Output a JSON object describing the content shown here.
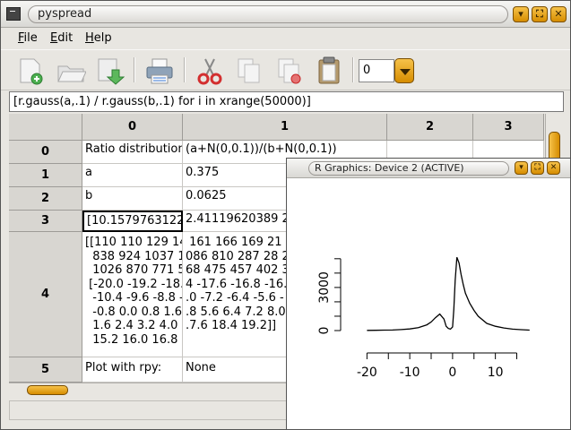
{
  "window": {
    "title": "pyspread"
  },
  "menu": [
    {
      "label": "File",
      "underline": "F",
      "rest": "ile"
    },
    {
      "label": "Edit",
      "underline": "E",
      "rest": "dit"
    },
    {
      "label": "Help",
      "underline": "H",
      "rest": "elp"
    }
  ],
  "toolbar": {
    "icons": [
      "new-icon",
      "open-icon",
      "save-icon",
      "print-icon",
      "cut-icon",
      "copy-icon",
      "copy-result-icon",
      "paste-icon"
    ],
    "table_selector": "0"
  },
  "formula": "[r.gauss(a,.1) / r.gauss(b,.1) for i in xrange(50000)]",
  "grid": {
    "columns": [
      "0",
      "1",
      "2",
      "3"
    ],
    "rows": [
      {
        "label": "0",
        "c0": "Ratio distribution",
        "c1": "(a+N(0,0.1))/(b+N(0,0.1))"
      },
      {
        "label": "1",
        "c0": "a",
        "c1": "0.375"
      },
      {
        "label": "2",
        "c0": "b",
        "c1": "0.0625"
      },
      {
        "label": "3",
        "c0": "[10.1579763122",
        "c1": "2.41119620389 2"
      },
      {
        "label": "4",
        "c0": "[[110 110 129 143\n  838 924 1037 1\n  1026 870 771 5\n [-20.0 -19.2 -18.4\n  -10.4 -9.6 -8.8 -8\n  -0.8 0.0 0.8 1.6 2\n  1.6 2.4 3.2 4.0 4\n  15.2 16.0 16.8 1",
        "c1": " 161 166 169 21\n086 810 287 28 29\n68 475 457 402 35\n4 -17.6 -16.8 -16.0\n.0 -7.2 -6.4 -5.6 -\n.8 5.6 6.4 7.2 8.0\n.7.6 18.4 19.2]]"
      },
      {
        "label": "5",
        "c0": "Plot with rpy:",
        "c1": "None"
      }
    ]
  },
  "rplot": {
    "title": "R Graphics: Device 2 (ACTIVE)",
    "chart_data": {
      "type": "line",
      "title": "",
      "xlabel": "",
      "ylabel": "",
      "x_ticks": [
        -20,
        -10,
        0,
        10
      ],
      "y_ticks": [
        0,
        3000
      ],
      "xlim": [
        -20.5,
        19.5
      ],
      "ylim": [
        0,
        5300
      ],
      "series": [
        {
          "x": [
            -20,
            -18,
            -16,
            -14,
            -12,
            -10,
            -8,
            -6,
            -5,
            -4,
            -3,
            -2,
            -1.5,
            -1,
            -0.5,
            0,
            0.3,
            0.6,
            1,
            1.5,
            2,
            2.5,
            3,
            4,
            5,
            6,
            8,
            10,
            12,
            14,
            16,
            18
          ],
          "y": [
            10,
            20,
            30,
            40,
            70,
            110,
            200,
            400,
            600,
            900,
            1150,
            800,
            300,
            150,
            100,
            250,
            1500,
            3500,
            5100,
            4700,
            3900,
            3200,
            2600,
            1900,
            1400,
            1000,
            500,
            300,
            180,
            100,
            60,
            30
          ]
        }
      ]
    }
  }
}
